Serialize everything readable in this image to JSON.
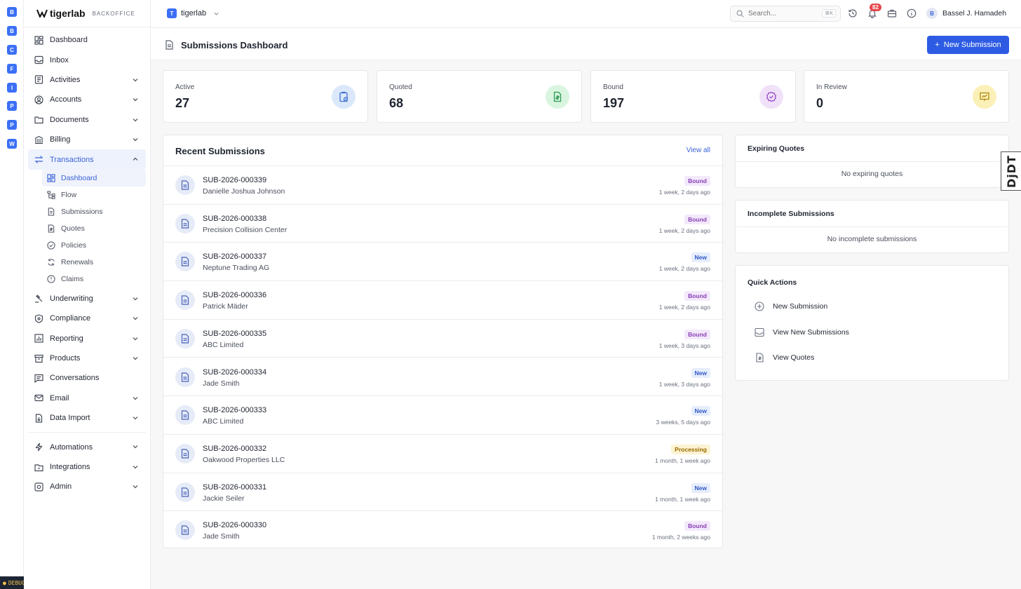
{
  "rail": {
    "items": [
      "B",
      "B",
      "C",
      "F",
      "I",
      "P",
      "P",
      "W"
    ]
  },
  "debug_label": "DEBUG",
  "brand": {
    "name": "tigerlab",
    "sub": "BACKOFFICE"
  },
  "nav": {
    "items": [
      {
        "label": "Dashboard",
        "icon": "dashboard-icon",
        "chevron": false
      },
      {
        "label": "Inbox",
        "icon": "inbox-icon",
        "chevron": false
      },
      {
        "label": "Activities",
        "icon": "activities-icon",
        "chevron": true
      },
      {
        "label": "Accounts",
        "icon": "accounts-icon",
        "chevron": true
      },
      {
        "label": "Documents",
        "icon": "folder-icon",
        "chevron": true
      },
      {
        "label": "Billing",
        "icon": "bank-icon",
        "chevron": true
      },
      {
        "label": "Transactions",
        "icon": "transactions-icon",
        "chevron": true,
        "active": true
      }
    ],
    "sub_items": [
      {
        "label": "Dashboard",
        "icon": "dashboard-icon",
        "active": true
      },
      {
        "label": "Flow",
        "icon": "flow-icon"
      },
      {
        "label": "Submissions",
        "icon": "document-icon"
      },
      {
        "label": "Quotes",
        "icon": "quote-icon"
      },
      {
        "label": "Policies",
        "icon": "policy-check-icon"
      },
      {
        "label": "Renewals",
        "icon": "refresh-icon"
      },
      {
        "label": "Claims",
        "icon": "alert-circle-icon"
      }
    ],
    "items_after": [
      {
        "label": "Underwriting",
        "icon": "gavel-icon",
        "chevron": true
      },
      {
        "label": "Compliance",
        "icon": "shield-icon",
        "chevron": true
      },
      {
        "label": "Reporting",
        "icon": "bar-chart-icon",
        "chevron": true
      },
      {
        "label": "Products",
        "icon": "archive-icon",
        "chevron": true
      },
      {
        "label": "Conversations",
        "icon": "message-icon",
        "chevron": false
      },
      {
        "label": "Email",
        "icon": "mail-icon",
        "chevron": true
      },
      {
        "label": "Data Import",
        "icon": "import-icon",
        "chevron": true
      }
    ],
    "items_bottom": [
      {
        "label": "Automations",
        "icon": "bolt-icon",
        "chevron": true
      },
      {
        "label": "Integrations",
        "icon": "integrations-icon",
        "chevron": true
      },
      {
        "label": "Admin",
        "icon": "admin-icon",
        "chevron": true
      }
    ]
  },
  "topbar": {
    "org_badge": "T",
    "org_name": "tigerlab",
    "search_placeholder": "Search...",
    "search_shortcut": "⌘K",
    "notification_count": "82",
    "user_initial": "B",
    "user_name": "Bassel J. Hamadeh"
  },
  "page": {
    "title": "Submissions Dashboard",
    "new_button": "New Submission"
  },
  "stats": [
    {
      "label": "Active",
      "value": "27",
      "icon": "clipboard-clock-icon",
      "bg": "#dbe8fb",
      "fg": "#3f6fd1"
    },
    {
      "label": "Quoted",
      "value": "68",
      "icon": "file-dollar-icon",
      "bg": "#d9f5e0",
      "fg": "#2c9a52"
    },
    {
      "label": "Bound",
      "value": "197",
      "icon": "badge-check-icon",
      "bg": "#f0e1f8",
      "fg": "#9a4fc7"
    },
    {
      "label": "In Review",
      "value": "0",
      "icon": "presentation-icon",
      "bg": "#fbf0b8",
      "fg": "#b08a10"
    }
  ],
  "recent": {
    "title": "Recent Submissions",
    "view_all": "View all",
    "rows": [
      {
        "id": "SUB-2026-000339",
        "name": "Danielle Joshua Johnson",
        "status": "Bound",
        "status_kind": "bound",
        "time": "1 week, 2 days ago"
      },
      {
        "id": "SUB-2026-000338",
        "name": "Precision Collision Center",
        "status": "Bound",
        "status_kind": "bound",
        "time": "1 week, 2 days ago"
      },
      {
        "id": "SUB-2026-000337",
        "name": "Neptune Trading AG",
        "status": "New",
        "status_kind": "new",
        "time": "1 week, 2 days ago"
      },
      {
        "id": "SUB-2026-000336",
        "name": "Patrick Mäder",
        "status": "Bound",
        "status_kind": "bound",
        "time": "1 week, 2 days ago"
      },
      {
        "id": "SUB-2026-000335",
        "name": "ABC Limited",
        "status": "Bound",
        "status_kind": "bound",
        "time": "1 week, 3 days ago"
      },
      {
        "id": "SUB-2026-000334",
        "name": "Jade Smith",
        "status": "New",
        "status_kind": "new",
        "time": "1 week, 3 days ago"
      },
      {
        "id": "SUB-2026-000333",
        "name": "ABC Limited",
        "status": "New",
        "status_kind": "new",
        "time": "3 weeks, 5 days ago"
      },
      {
        "id": "SUB-2026-000332",
        "name": "Oakwood Properties LLC",
        "status": "Processing",
        "status_kind": "processing",
        "time": "1 month, 1 week ago"
      },
      {
        "id": "SUB-2026-000331",
        "name": "Jackie Seiler",
        "status": "New",
        "status_kind": "new",
        "time": "1 month, 1 week ago"
      },
      {
        "id": "SUB-2026-000330",
        "name": "Jade Smith",
        "status": "Bound",
        "status_kind": "bound",
        "time": "1 month, 2 weeks ago"
      }
    ]
  },
  "expiring": {
    "title": "Expiring Quotes",
    "empty": "No expiring quotes"
  },
  "incomplete": {
    "title": "Incomplete Submissions",
    "empty": "No incomplete submissions"
  },
  "quick_actions": {
    "title": "Quick Actions",
    "items": [
      {
        "label": "New Submission",
        "icon": "plus-circle-icon"
      },
      {
        "label": "View New Submissions",
        "icon": "inbox-icon"
      },
      {
        "label": "View Quotes",
        "icon": "quote-icon"
      }
    ]
  },
  "djdt_label": "DjDT"
}
